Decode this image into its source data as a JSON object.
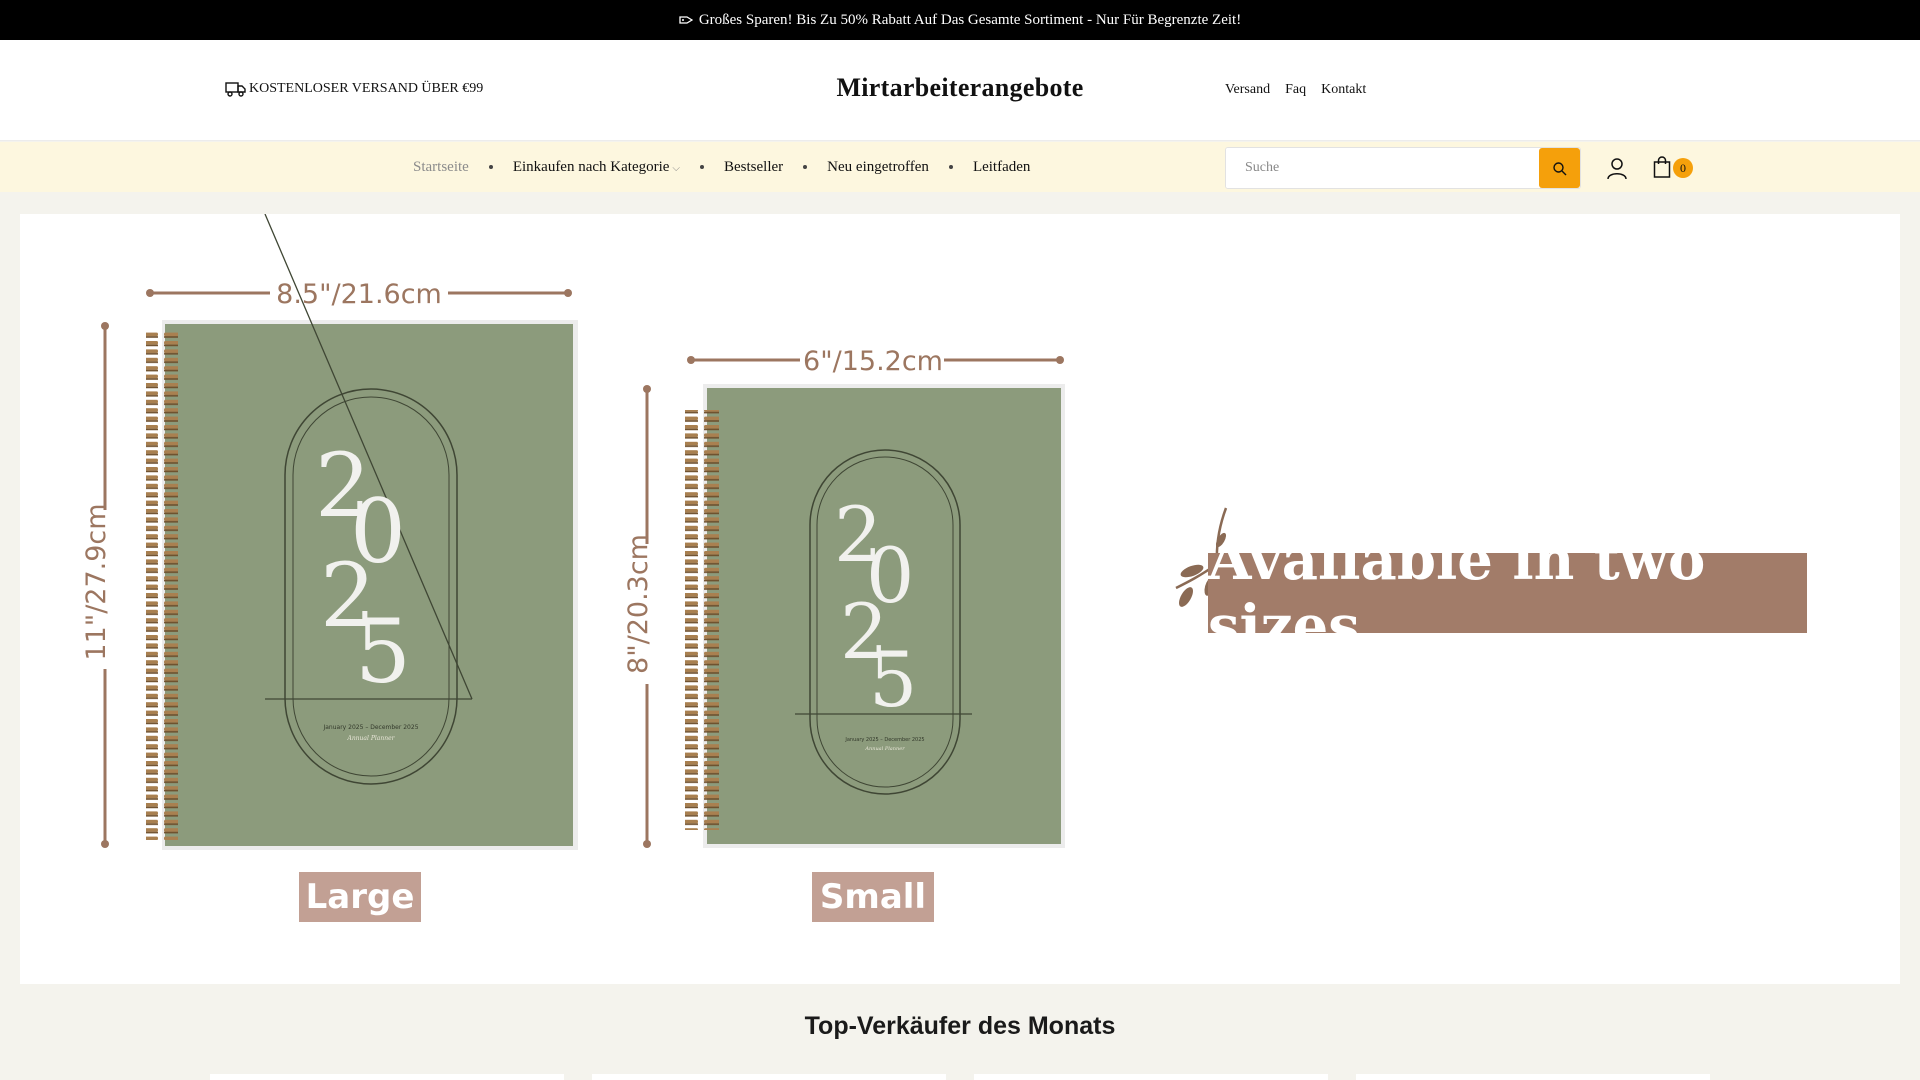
{
  "announcement": {
    "text": "Großes Sparen! Bis Zu 50% Rabatt Auf Das Gesamte Sortiment - Nur Für Begrenzte Zeit!",
    "icon": "tag-icon"
  },
  "header": {
    "shipping_text": "KOSTENLOSER VERSAND ÜBER €99",
    "shipping_icon": "truck-icon",
    "logo": "Mirtarbeiterangebote",
    "links": [
      "Versand",
      "Faq",
      "Kontakt"
    ]
  },
  "nav": {
    "items": [
      {
        "label": "Startseite",
        "active": true
      },
      {
        "label": "Einkaufen nach Kategorie",
        "has_dropdown": true
      },
      {
        "label": "Bestseller"
      },
      {
        "label": "Neu eingetroffen"
      },
      {
        "label": "Leitfaden"
      }
    ],
    "search_placeholder": "Suche",
    "cart_count": "0"
  },
  "banner": {
    "large": {
      "width_label": "8.5\"/21.6cm",
      "height_label": "11\"/27.9cm",
      "size_label": "Large",
      "year": "2025",
      "cover_small_text": "January 2025 – December 2025",
      "cover_script_text": "Annual Planner"
    },
    "small": {
      "width_label": "6\"/15.2cm",
      "height_label": "8\"/20.3cm",
      "size_label": "Small",
      "year": "2025",
      "cover_small_text": "January 2025 – December 2025",
      "cover_script_text": "Annual Planner"
    },
    "headline": "Available in two sizes"
  },
  "section": {
    "title": "Top-Verkäufer des Monats"
  },
  "colors": {
    "accent": "#f5a00b",
    "nav_bg": "#fdf7df",
    "page_bg": "#f4f3ed",
    "cover_green": "#8c9b7c",
    "brown": "#a27c69"
  }
}
